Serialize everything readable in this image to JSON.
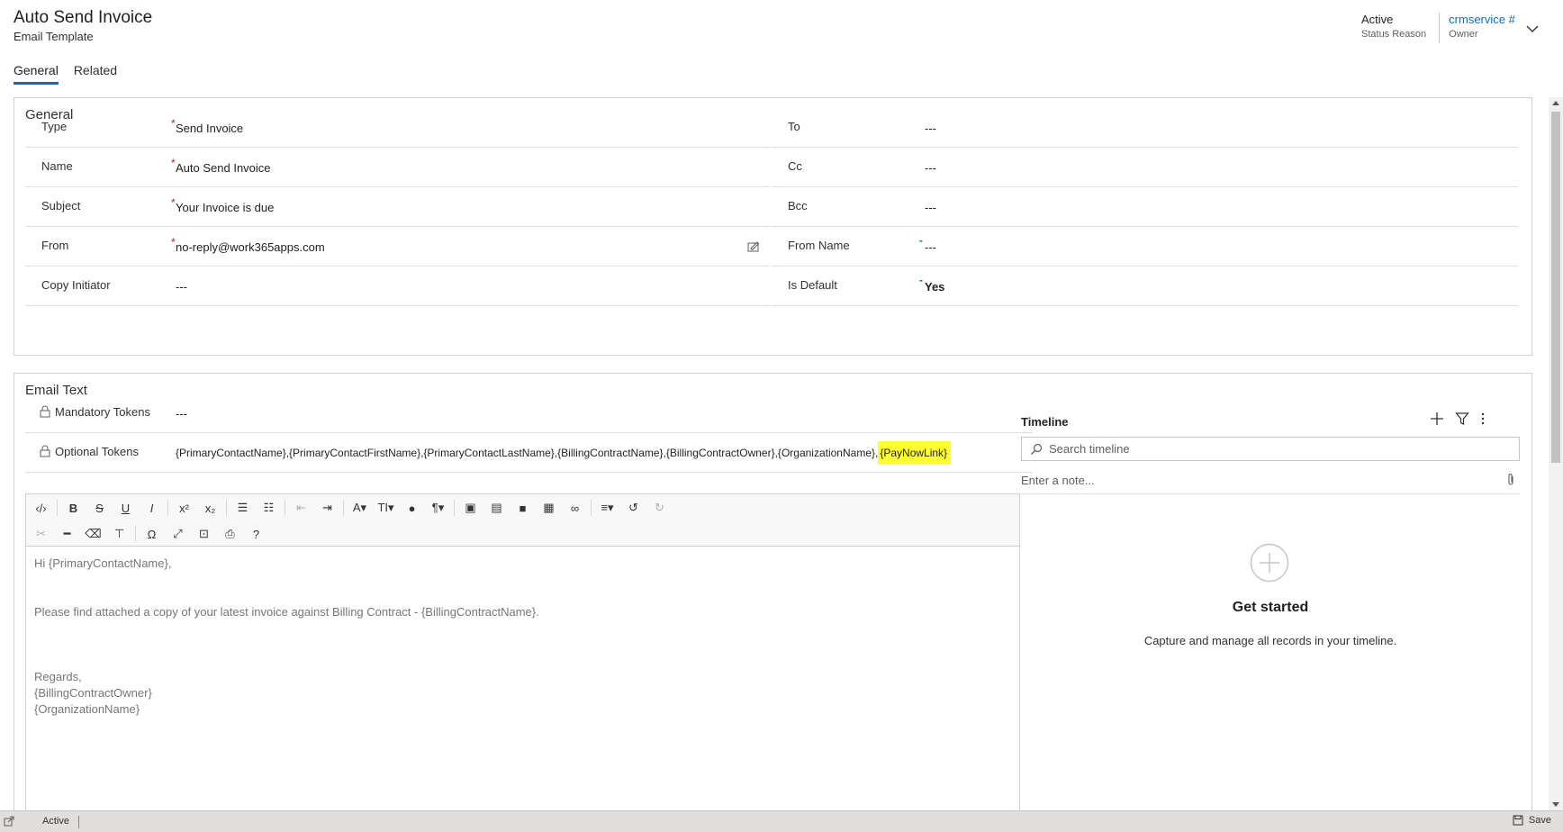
{
  "header": {
    "title": "Auto Send Invoice",
    "subtitle": "Email Template",
    "status_value": "Active",
    "status_label": "Status Reason",
    "owner_value": "crmservice #",
    "owner_label": "Owner"
  },
  "tabs": [
    {
      "label": "General",
      "active": true
    },
    {
      "label": "Related",
      "active": false
    }
  ],
  "general": {
    "title": "General",
    "left": [
      {
        "label": "Type",
        "required": "*",
        "value": "Send Invoice"
      },
      {
        "label": "Name",
        "required": "*",
        "value": "Auto Send Invoice"
      },
      {
        "label": "Subject",
        "required": "*",
        "value": "Your Invoice is due"
      },
      {
        "label": "From",
        "required": "*",
        "value": "no-reply@work365apps.com"
      },
      {
        "label": "Copy Initiator",
        "value": "---"
      }
    ],
    "right": [
      {
        "label": "To",
        "value": "---"
      },
      {
        "label": "Cc",
        "value": "---"
      },
      {
        "label": "Bcc",
        "value": "---"
      },
      {
        "label": "From Name",
        "recommended": "-",
        "value": "---"
      },
      {
        "label": "Is Default",
        "recommended": "-",
        "value": "Yes"
      }
    ]
  },
  "email_text": {
    "title": "Email Text",
    "mandatory_label": "Mandatory Tokens",
    "mandatory_value": "---",
    "optional_label": "Optional Tokens",
    "optional_value": "{PrimaryContactName},{PrimaryContactFirstName},{PrimaryContactLastName},{BillingContractName},{BillingContractOwner},{OrganizationName},",
    "optional_highlight": "{PayNowLink}",
    "body": [
      "Hi {PrimaryContactName},",
      "",
      "",
      "Please find attached a copy of your latest invoice against Billing Contract - {BillingContractName}.",
      "",
      "",
      "",
      "Regards,",
      "{BillingContractOwner}",
      "{OrganizationName}"
    ]
  },
  "toolbar": {
    "row1": [
      {
        "name": "source-button",
        "glyph": "‹/›"
      },
      {
        "sep": true
      },
      {
        "name": "bold-button",
        "glyph": "B"
      },
      {
        "name": "strikethrough-button",
        "glyph": "S"
      },
      {
        "name": "underline-button",
        "glyph": "U"
      },
      {
        "name": "italic-button",
        "glyph": "I"
      },
      {
        "sep": true
      },
      {
        "name": "superscript-button",
        "glyph": "x²"
      },
      {
        "name": "subscript-button",
        "glyph": "x₂"
      },
      {
        "sep": true
      },
      {
        "name": "bulleted-list-button",
        "glyph": "☰"
      },
      {
        "name": "numbered-list-button",
        "glyph": "☷"
      },
      {
        "sep": true
      },
      {
        "name": "decrease-indent-button",
        "glyph": "⇤",
        "disabled": true
      },
      {
        "name": "increase-indent-button",
        "glyph": "⇥"
      },
      {
        "sep": true
      },
      {
        "name": "font-color-button",
        "glyph": "A▾"
      },
      {
        "name": "font-size-button",
        "glyph": "TI▾"
      },
      {
        "name": "highlight-button",
        "glyph": "●"
      },
      {
        "name": "paragraph-button",
        "glyph": "¶▾"
      },
      {
        "sep": true
      },
      {
        "name": "image-button",
        "glyph": "▣"
      },
      {
        "name": "file-button",
        "glyph": "▤"
      },
      {
        "name": "video-button",
        "glyph": "■"
      },
      {
        "name": "table-button",
        "glyph": "▦"
      },
      {
        "name": "link-button",
        "glyph": "∞"
      },
      {
        "sep": true
      },
      {
        "name": "align-button",
        "glyph": "≡▾"
      },
      {
        "name": "undo-button",
        "glyph": "↺"
      },
      {
        "name": "redo-button",
        "glyph": "↻",
        "disabled": true
      }
    ],
    "row2": [
      {
        "name": "cut-button",
        "glyph": "✂",
        "disabled": true
      },
      {
        "name": "horizontal-line-button",
        "glyph": "━"
      },
      {
        "name": "clear-format-button",
        "glyph": "⌫"
      },
      {
        "name": "format-painter-button",
        "glyph": "⊤"
      },
      {
        "sep": true
      },
      {
        "name": "special-char-button",
        "glyph": "Ω"
      },
      {
        "name": "fullscreen-button",
        "glyph": "⤢"
      },
      {
        "name": "select-all-button",
        "glyph": "⊡"
      },
      {
        "name": "print-button",
        "glyph": "⎙"
      },
      {
        "name": "help-button",
        "glyph": "?"
      }
    ]
  },
  "timeline": {
    "title": "Timeline",
    "search_placeholder": "Search timeline",
    "note_placeholder": "Enter a note...",
    "empty_title": "Get started",
    "empty_caption": "Capture and manage all records in your timeline."
  },
  "statusbar": {
    "status": "Active",
    "save_label": "Save"
  },
  "colors": {
    "accent": "#0f6cbd",
    "required": "#a4262c",
    "highlight": "#ffff33"
  }
}
